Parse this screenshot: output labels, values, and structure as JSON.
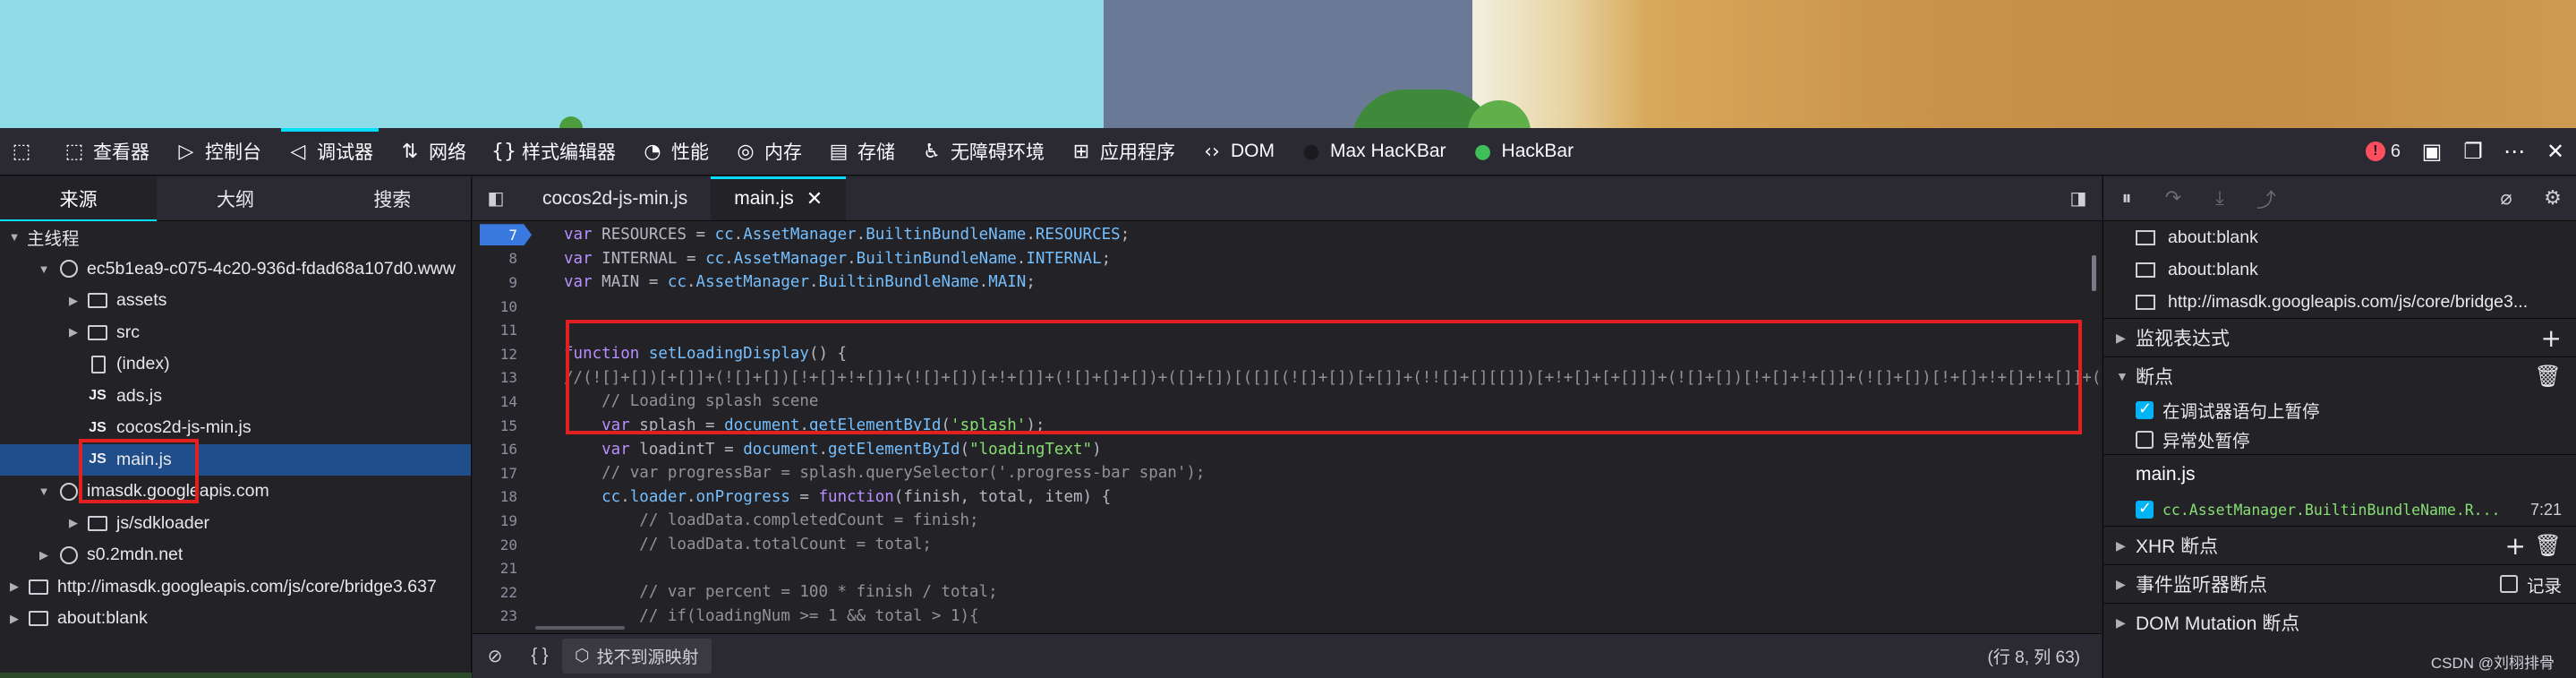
{
  "toolbar": {
    "tools": [
      {
        "icon": "inspector-icon",
        "glyph": "⬚",
        "label": "查看器"
      },
      {
        "icon": "console-icon",
        "glyph": "▷",
        "label": "控制台"
      },
      {
        "icon": "debugger-icon",
        "glyph": "◁",
        "label": "调试器"
      },
      {
        "icon": "network-icon",
        "glyph": "⇅",
        "label": "网络"
      },
      {
        "icon": "style-editor-icon",
        "glyph": "{}",
        "label": "样式编辑器"
      },
      {
        "icon": "performance-icon",
        "glyph": "◔",
        "label": "性能"
      },
      {
        "icon": "memory-icon",
        "glyph": "◎",
        "label": "内存"
      },
      {
        "icon": "storage-icon",
        "glyph": "▤",
        "label": "存储"
      },
      {
        "icon": "accessibility-icon",
        "glyph": "♿",
        "label": "无障碍环境"
      },
      {
        "icon": "application-icon",
        "glyph": "⊞",
        "label": "应用程序"
      },
      {
        "icon": "dom-icon",
        "glyph": "‹›",
        "label": "DOM"
      },
      {
        "icon": "max-hackbar-icon",
        "glyph": "●",
        "label": "Max HacKBar"
      },
      {
        "icon": "hackbar-icon",
        "glyph": "●",
        "label": "HackBar"
      }
    ],
    "error_count": "6"
  },
  "left_panel": {
    "tabs": [
      "来源",
      "大纲",
      "搜索"
    ],
    "tree": [
      {
        "label": "主线程",
        "indent": 0,
        "icon": "none",
        "twisty": "▼"
      },
      {
        "label": "ec5b1ea9-c075-4c20-936d-fdad68a107d0.www",
        "indent": 1,
        "icon": "globe",
        "twisty": "▼"
      },
      {
        "label": "assets",
        "indent": 2,
        "icon": "folder",
        "twisty": "▶"
      },
      {
        "label": "src",
        "indent": 2,
        "icon": "folder",
        "twisty": "▶"
      },
      {
        "label": "(index)",
        "indent": 2,
        "icon": "file",
        "twisty": ""
      },
      {
        "label": "ads.js",
        "indent": 2,
        "icon": "js",
        "twisty": ""
      },
      {
        "label": "cocos2d-js-min.js",
        "indent": 2,
        "icon": "js",
        "twisty": ""
      },
      {
        "label": "main.js",
        "indent": 2,
        "icon": "js",
        "twisty": "",
        "selected": true
      },
      {
        "label": "imasdk.googleapis.com",
        "indent": 1,
        "icon": "globe",
        "twisty": "▼"
      },
      {
        "label": "js/sdkloader",
        "indent": 2,
        "icon": "folder",
        "twisty": "▶"
      },
      {
        "label": "s0.2mdn.net",
        "indent": 1,
        "icon": "globe",
        "twisty": "▶"
      },
      {
        "label": "http://imasdk.googleapis.com/js/core/bridge3.637",
        "indent": 0,
        "icon": "page",
        "twisty": "▶"
      },
      {
        "label": "about:blank",
        "indent": 0,
        "icon": "page",
        "twisty": "▶"
      }
    ]
  },
  "editor": {
    "tabs": [
      {
        "label": "cocos2d-js-min.js",
        "active": false
      },
      {
        "label": "main.js",
        "active": true
      }
    ],
    "breakpoint_line": "7",
    "lines": [
      {
        "n": "7",
        "bp": true,
        "tokens": [
          [
            "kw",
            "var "
          ],
          [
            "pn",
            "RESOURCES = "
          ],
          [
            "pr",
            "cc"
          ],
          [
            "pn",
            "."
          ],
          [
            "pr",
            "AssetManager"
          ],
          [
            "pn",
            "."
          ],
          [
            "pr",
            "BuiltinBundleName"
          ],
          [
            "pn",
            "."
          ],
          [
            "pr",
            "RESOURCES"
          ],
          [
            "pn",
            ";"
          ]
        ]
      },
      {
        "n": "8",
        "tokens": [
          [
            "kw",
            "var "
          ],
          [
            "pn",
            "INTERNAL = "
          ],
          [
            "pr",
            "cc"
          ],
          [
            "pn",
            "."
          ],
          [
            "pr",
            "AssetManager"
          ],
          [
            "pn",
            "."
          ],
          [
            "pr",
            "BuiltinBundleName"
          ],
          [
            "pn",
            "."
          ],
          [
            "pr",
            "INTERNAL"
          ],
          [
            "pn",
            ";"
          ]
        ]
      },
      {
        "n": "9",
        "tokens": [
          [
            "kw",
            "var "
          ],
          [
            "pn",
            "MAIN = "
          ],
          [
            "pr",
            "cc"
          ],
          [
            "pn",
            "."
          ],
          [
            "pr",
            "AssetManager"
          ],
          [
            "pn",
            "."
          ],
          [
            "pr",
            "BuiltinBundleName"
          ],
          [
            "pn",
            "."
          ],
          [
            "pr",
            "MAIN"
          ],
          [
            "pn",
            ";"
          ]
        ]
      },
      {
        "n": "10",
        "tokens": []
      },
      {
        "n": "11",
        "tokens": []
      },
      {
        "n": "12",
        "tokens": [
          [
            "kw",
            "function "
          ],
          [
            "fn",
            "setLoadingDisplay"
          ],
          [
            "pn",
            "() {"
          ]
        ]
      },
      {
        "n": "13",
        "tokens": [
          [
            "cm",
            "//(![]+[])[+[]]+(![]+[])[!+[]+!+[]]+(![]+[])[+!+[]]+(![]+[]+[])+([]+[])[([][(![]+[])[+[]]+(!![]+[][[]])[+!+[]+[+[]]]+(![]+[])[!+[]+!+[]]+(![]+[])[!+[]+!+[]+!+[]]+(![]+[])[!+[]+!+[]+!+[]]+[])"
          ]
        ]
      },
      {
        "n": "14",
        "tokens": [
          [
            "cm",
            "    // Loading splash scene"
          ]
        ]
      },
      {
        "n": "15",
        "tokens": [
          [
            "kw",
            "    var "
          ],
          [
            "pn",
            "splash = "
          ],
          [
            "pr",
            "document"
          ],
          [
            "pn",
            "."
          ],
          [
            "fn",
            "getElementById"
          ],
          [
            "pn",
            "("
          ],
          [
            "st",
            "'splash'"
          ],
          [
            "pn",
            ");"
          ]
        ]
      },
      {
        "n": "16",
        "tokens": [
          [
            "kw",
            "    var "
          ],
          [
            "pn",
            "loadintT = "
          ],
          [
            "pr",
            "document"
          ],
          [
            "pn",
            "."
          ],
          [
            "fn",
            "getElementById"
          ],
          [
            "pn",
            "("
          ],
          [
            "st",
            "\"loadingText\""
          ],
          [
            "pn",
            ")"
          ]
        ]
      },
      {
        "n": "17",
        "tokens": [
          [
            "cm",
            "    // var progressBar = splash.querySelector('.progress-bar span');"
          ]
        ]
      },
      {
        "n": "18",
        "tokens": [
          [
            "pr",
            "    cc"
          ],
          [
            "pn",
            "."
          ],
          [
            "pr",
            "loader"
          ],
          [
            "pn",
            "."
          ],
          [
            "fn",
            "onProgress"
          ],
          [
            "pn",
            " = "
          ],
          [
            "kw",
            "function"
          ],
          [
            "pn",
            "(finish, total, item) {"
          ]
        ]
      },
      {
        "n": "19",
        "tokens": [
          [
            "cm",
            "        // loadData.completedCount = finish;"
          ]
        ]
      },
      {
        "n": "20",
        "tokens": [
          [
            "cm",
            "        // loadData.totalCount = total;"
          ]
        ]
      },
      {
        "n": "21",
        "tokens": []
      },
      {
        "n": "22",
        "tokens": [
          [
            "cm",
            "        // var percent = 100 * finish / total;"
          ]
        ]
      },
      {
        "n": "23",
        "tokens": [
          [
            "cm",
            "        // if(loadingNum >= 1 && total > 1){"
          ]
        ]
      }
    ],
    "footer": {
      "source_map_label": "找不到源映射",
      "cursor_position": "(行 8, 列 63)"
    }
  },
  "right_panel": {
    "threads": [
      {
        "label": "about:blank"
      },
      {
        "label": "about:blank"
      },
      {
        "label": "http://imasdk.googleapis.com/js/core/bridge3..."
      }
    ],
    "watch_label": "监视表达式",
    "breakpoints_label": "断点",
    "pause_on_debugger": "在调试器语句上暂停",
    "pause_on_exceptions": "异常处暂停",
    "bp_file": "main.js",
    "bp_entry_code": "cc.AssetManager.BuiltinBundleName.R...",
    "bp_entry_pos": "7:21",
    "xhr_label": "XHR 断点",
    "event_label": "事件监听器断点",
    "record_label": "记录",
    "dom_mutation_label": "DOM Mutation 断点",
    "watermark": "CSDN @刘栩排骨"
  }
}
